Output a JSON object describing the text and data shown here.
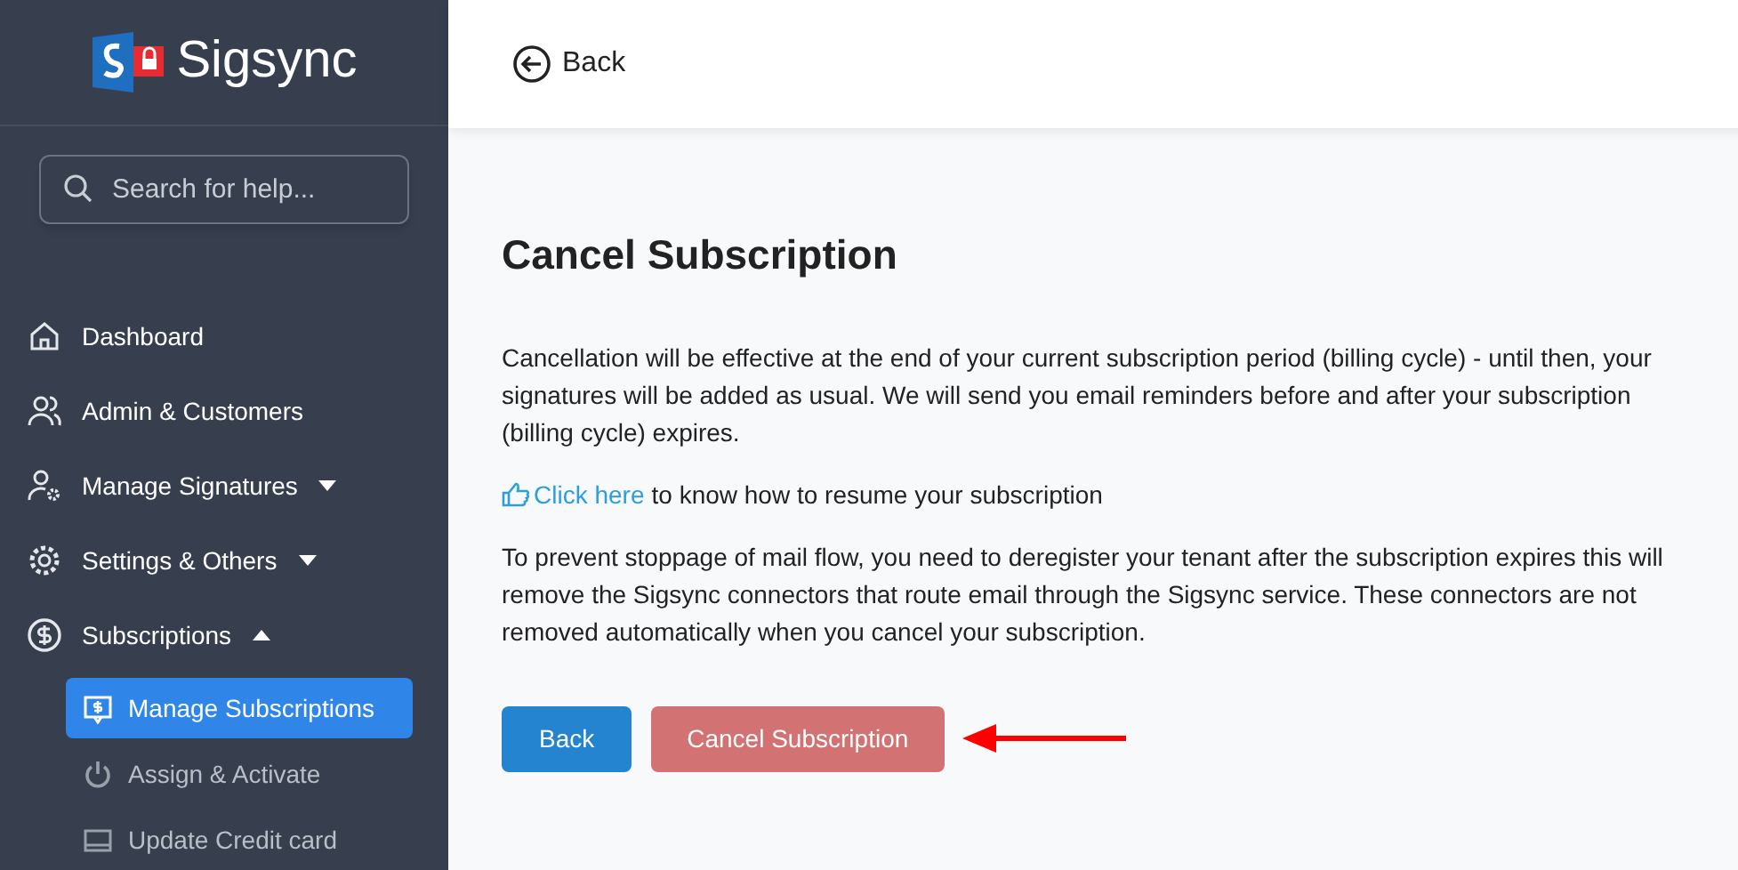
{
  "brand": {
    "name": "Sigsync"
  },
  "search": {
    "placeholder": "Search for help..."
  },
  "sidebar": {
    "items": [
      {
        "kind": "link",
        "label": "Dashboard"
      },
      {
        "kind": "link",
        "label": "Admin & Customers"
      },
      {
        "kind": "group",
        "label": "Manage Signatures",
        "expanded": false
      },
      {
        "kind": "group",
        "label": "Settings & Others",
        "expanded": false
      },
      {
        "kind": "group",
        "label": "Subscriptions",
        "expanded": true,
        "children": [
          {
            "label": "Manage Subscriptions",
            "selected": true
          },
          {
            "label": "Assign & Activate",
            "selected": false
          },
          {
            "label": "Update Credit card",
            "selected": false
          }
        ]
      }
    ]
  },
  "header": {
    "back_label": "Back"
  },
  "page": {
    "title": "Cancel Subscription",
    "paragraphs": [
      {
        "kind": "text",
        "text": "Cancellation will be effective at the end of your current subscription period (billing cycle) - until then, your signatures will be added as usual. We will send you email reminders before and after your subscription (billing cycle) expires."
      },
      {
        "kind": "link",
        "link": "Click here",
        "text": "to know how to resume your subscription"
      },
      {
        "kind": "text",
        "text": "To prevent stoppage of mail flow, you need to deregister your tenant after the subscription expires this will remove the Sigsync connectors that route email through the Sigsync service. These connectors are not removed automatically when you cancel your subscription."
      }
    ],
    "buttons": [
      {
        "kind": "primary",
        "label": "Back"
      },
      {
        "kind": "danger",
        "label": "Cancel Subscription"
      }
    ]
  }
}
